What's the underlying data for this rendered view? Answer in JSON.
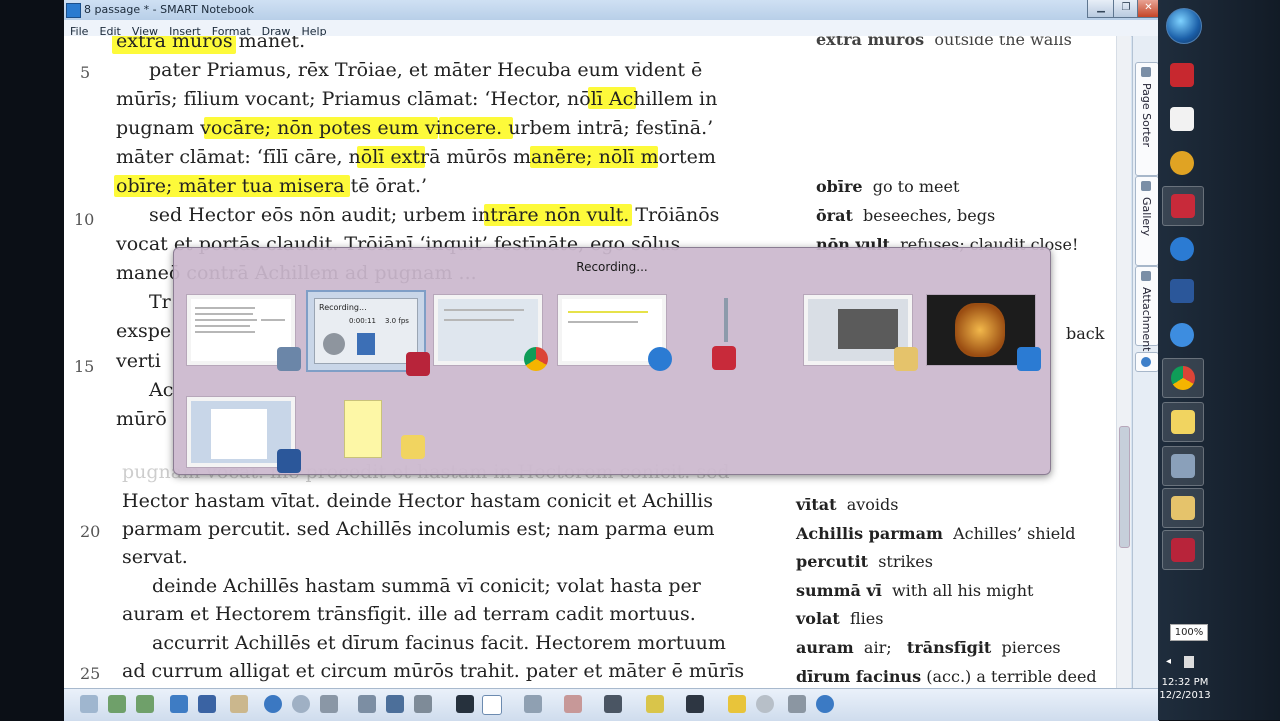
{
  "window": {
    "title": "8 passage * - SMART Notebook",
    "menu": [
      "File",
      "Edit",
      "View",
      "Insert",
      "Format",
      "Draw",
      "Help"
    ]
  },
  "side_tabs": [
    "Page Sorter",
    "Gallery",
    "Attachments"
  ],
  "passage": {
    "top_partial": "extra mūrōs manet.",
    "lines": [
      {
        "num": "5",
        "text": "pater Priamus, rēx Trōiae, et māter Hecuba eum vident ē"
      },
      {
        "num": "",
        "text": "mūrīs; fīlium vocant; Priamus clāmat: ‘Hector, nōlī Achillem in"
      },
      {
        "num": "",
        "text": "pugnam vocāre; nōn potes eum vincere. urbem intrā; festīnā.’"
      },
      {
        "num": "",
        "text": "māter clāmat: ‘fīlī cāre, nōlī extrā mūrōs manēre; nōlī mortem"
      },
      {
        "num": "",
        "text": "obīre; māter tua misera tē ōrat.’"
      },
      {
        "num": "10",
        "text": "sed Hector eōs nōn audit; urbem intrāre nōn vult. Trōiānōs"
      },
      {
        "num": "",
        "text": "vocat et portās claudit. Trōiānī ‘inquit’ festīnāte, ego sōlus"
      },
      {
        "num": "",
        "text": "maneō contrā Achillem ad pugnam ..."
      },
      {
        "num": "",
        "text": "Tr"
      },
      {
        "num": "",
        "text": "exspe"
      },
      {
        "num": "15",
        "text": "verti"
      },
      {
        "num": "",
        "text": "Ac"
      },
      {
        "num": "",
        "text": "mūrō"
      }
    ],
    "lower_lines": [
      {
        "num": "",
        "text": "pugnam vocat. ille procedit et hastam in Hectorem conicit. sed"
      },
      {
        "num": "",
        "text": "Hector hastam vītat. deinde Hector hastam conicit et Achillis"
      },
      {
        "num": "20",
        "text": "parmam percutit. sed Achillēs incolumis est; nam parma eum"
      },
      {
        "num": "",
        "text": "servat."
      },
      {
        "num": "",
        "text": "deinde Achillēs hastam summā vī conicit; volat hasta per"
      },
      {
        "num": "",
        "text": "auram et Hectorem trānsfīgit. ille ad terram cadit mortuus."
      },
      {
        "num": "",
        "text": "accurrit Achillēs et dīrum facinus facit. Hectorem mortuum"
      },
      {
        "num": "25",
        "text": "ad currum alligat et circum mūrōs trahit. pater et māter ē mūrīs"
      }
    ]
  },
  "glossary": {
    "top": {
      "term": "extra muros",
      "def": "outside the walls"
    },
    "items": [
      {
        "term": "obīre",
        "def": "go to meet"
      },
      {
        "term": "ōrat",
        "def": "beseeches, begs"
      },
      {
        "term": "nōn vult",
        "def": "refuses; claudit close!"
      }
    ],
    "partial_right": "back",
    "lower": [
      {
        "term": "vītat",
        "def": "avoids"
      },
      {
        "term": "Achillis parmam",
        "def": "Achilles’ shield"
      },
      {
        "term": "percutit",
        "def": "strikes"
      },
      {
        "term": "summā vī",
        "def": "with all his might"
      },
      {
        "term": "volat",
        "def": "flies"
      },
      {
        "term": "auram",
        "def": "air;"
      },
      {
        "term": "trānsfīgit",
        "def": "pierces"
      },
      {
        "term": "dīrum facinus",
        "def": "(acc.) a terrible deed"
      }
    ]
  },
  "switcher": {
    "title": "Recording...",
    "recorder": {
      "time": "0:00:11",
      "fps": "3.0 fps",
      "label": "Recording..."
    },
    "windows": [
      "smart-notebook",
      "recorder",
      "chrome",
      "smart-pen",
      "internet-explorer",
      "smart-notebook-small",
      "explorer-folder",
      "desktop-guitar",
      "word-document",
      "sticky-notes"
    ]
  },
  "taskbar": {
    "battery": "100%",
    "time": "12:32 PM",
    "date": "12/2/2013"
  }
}
